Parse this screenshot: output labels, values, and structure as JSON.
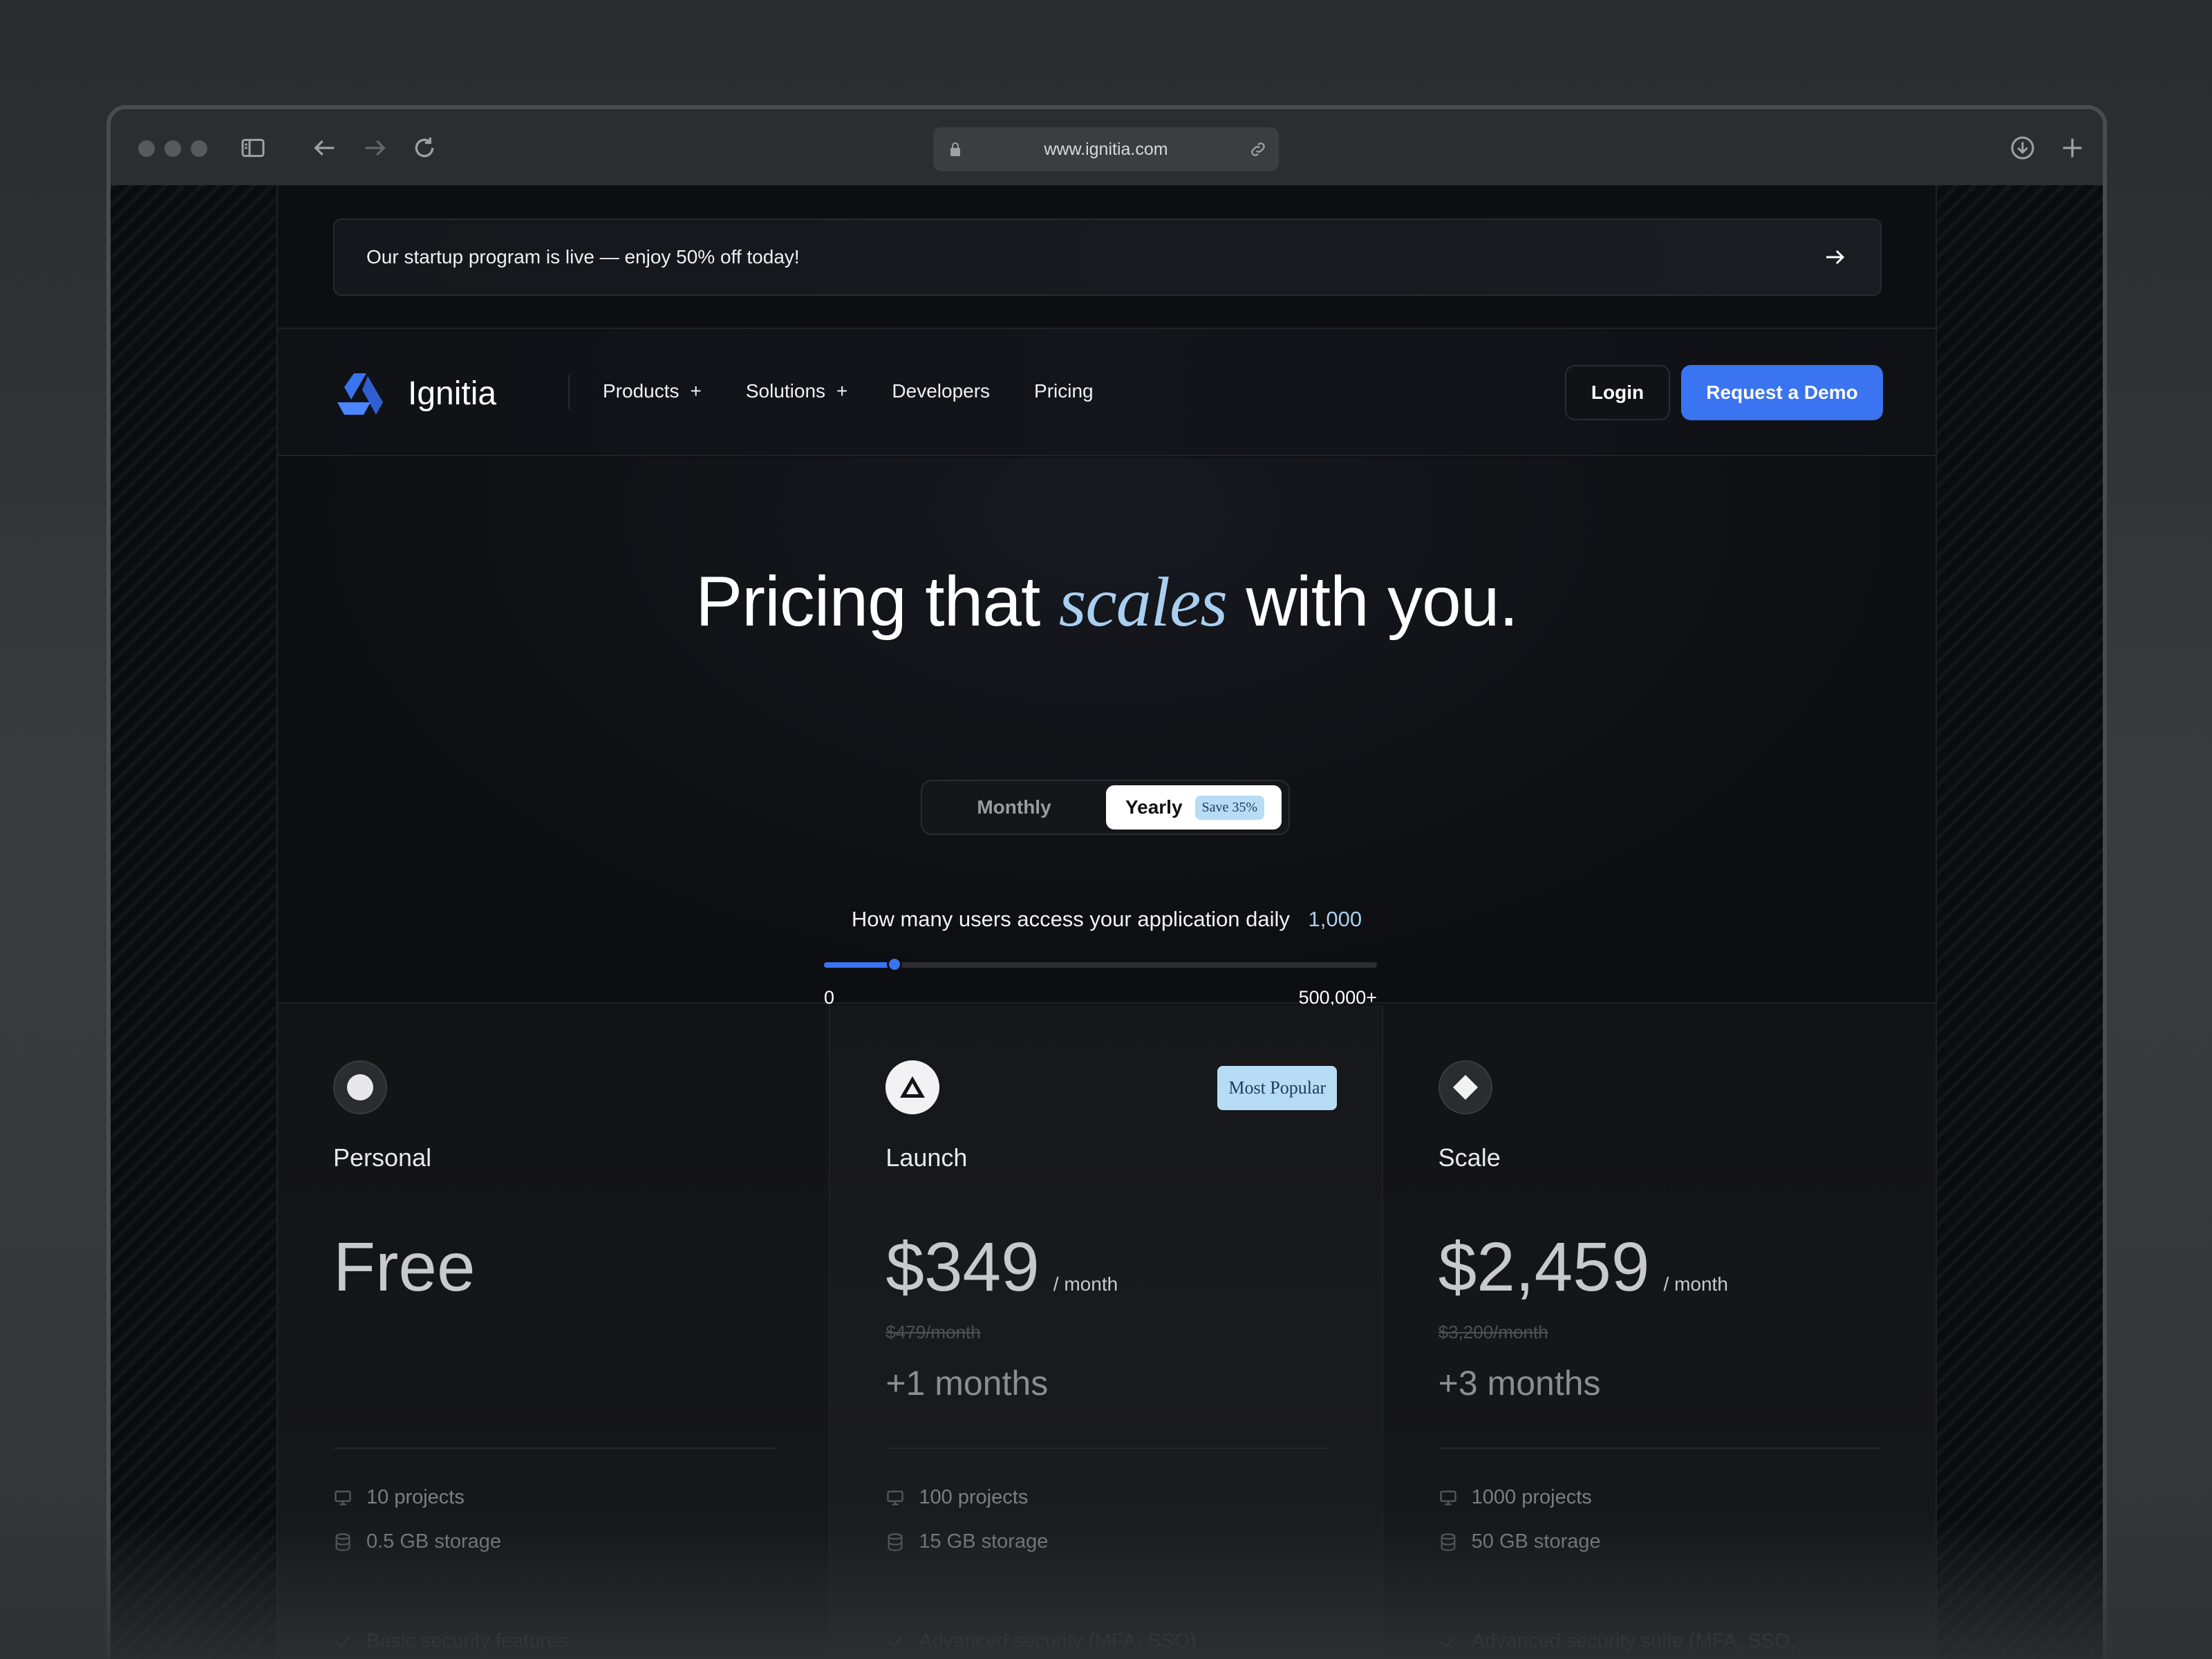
{
  "browser": {
    "url": "www.ignitia.com"
  },
  "banner": {
    "text": "Our startup program is live — enjoy 50% off today!"
  },
  "nav": {
    "brand": "Ignitia",
    "items": [
      {
        "label": "Products",
        "has_submenu": true
      },
      {
        "label": "Solutions",
        "has_submenu": true
      },
      {
        "label": "Developers",
        "has_submenu": false
      },
      {
        "label": "Pricing",
        "has_submenu": false
      }
    ],
    "login_label": "Login",
    "demo_label": "Request a Demo"
  },
  "hero": {
    "headline_pre": "Pricing that",
    "headline_em": "scales",
    "headline_post": "with you.",
    "toggle": {
      "monthly_label": "Monthly",
      "yearly_label": "Yearly",
      "save_badge": "Save 35%",
      "selected": "Yearly"
    },
    "users": {
      "question": "How many users access your application daily",
      "value": "1,000",
      "min_label": "0",
      "max_label": "500,000+",
      "fraction": 0.128
    }
  },
  "plans": [
    {
      "name": "Personal",
      "icon": "circle-icon",
      "price": "Free",
      "per": "",
      "old_price": "",
      "bonus": "",
      "badge": "",
      "features": [
        "10 projects",
        "0.5 GB storage"
      ],
      "faded_feature": "Basic security features"
    },
    {
      "name": "Launch",
      "icon": "triangle-icon",
      "price": "$349",
      "per": "/ month",
      "old_price": "$479/month",
      "bonus": "+1 months",
      "badge": "Most Popular",
      "features": [
        "100 projects",
        "15 GB storage"
      ],
      "faded_feature": "Advanced security (MFA, SSO)"
    },
    {
      "name": "Scale",
      "icon": "diamond-icon",
      "price": "$2,459",
      "per": "/ month",
      "old_price": "$3,200/month",
      "bonus": "+3 months",
      "badge": "",
      "features": [
        "1000 projects",
        "50 GB storage"
      ],
      "faded_feature": "Advanced security suite (MFA, SSO,"
    }
  ],
  "colors": {
    "accent": "#3a74f0",
    "highlight": "#a9cff0",
    "badge_bg": "#b7dcf5"
  }
}
